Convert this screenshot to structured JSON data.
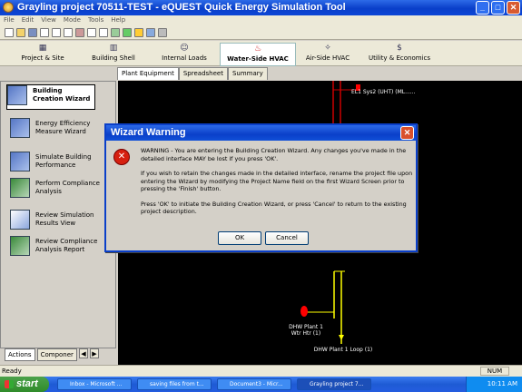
{
  "window": {
    "title": "Grayling project 70511-TEST - eQUEST Quick Energy Simulation Tool",
    "controls": {
      "minimize": "_",
      "maximize": "□",
      "close": "✕"
    }
  },
  "menu": [
    "File",
    "Edit",
    "View",
    "Mode",
    "Tools",
    "Help"
  ],
  "toolbar_icons": [
    "new-icon",
    "open-icon",
    "save-icon",
    "print-icon",
    "cut-icon",
    "copy-icon",
    "paste-icon",
    "undo-icon",
    "redo-icon",
    "properties-icon",
    "check-icon",
    "run-icon",
    "report-icon",
    "3d-view-icon"
  ],
  "modules": [
    {
      "label": "Project & Site",
      "icon": "▦"
    },
    {
      "label": "Building Shell",
      "icon": "▥"
    },
    {
      "label": "Internal Loads",
      "icon": "☺"
    },
    {
      "label": "Water-Side HVAC",
      "icon": "♨"
    },
    {
      "label": "Air-Side HVAC",
      "icon": "✧"
    },
    {
      "label": "Utility & Economics",
      "icon": "$"
    }
  ],
  "view_tabs": [
    "Plant Equipment",
    "Spreadsheet",
    "Summary"
  ],
  "actions": [
    "Building Creation Wizard",
    "Energy Efficiency Measure Wizard",
    "Simulate Building Performance",
    "Perform Compliance Analysis",
    "Review Simulation Results View",
    "Review Compliance Analysis Report"
  ],
  "left_tabs": {
    "actions": "Actions",
    "components": "Componer",
    "prev": "◀",
    "next": "▶"
  },
  "canvas_labels": {
    "system": "EL1 Sys2 (UHT) (ML......",
    "plant": "DHW Plant 1 Wtr Htr (1)",
    "loop": "DHW Plant 1 Loop (1)"
  },
  "dialog": {
    "title": "Wizard Warning",
    "icon": "error-icon",
    "lines": [
      "WARNING - You are entering the Building Creation Wizard.  Any changes you've made in the detailed interface MAY be lost if you press 'OK'.",
      "If you wish to retain the changes made in the detailed interface, rename the project file upon entering the Wizard by modifying the Project Name field on the first Wizard Screen prior to pressing the 'Finish' button.",
      "Press 'OK' to initiate the Building Creation Wizard, or press 'Cancel' to return to the existing project description."
    ],
    "ok": "OK",
    "cancel": "Cancel",
    "close": "✕"
  },
  "status": {
    "text": "Ready",
    "num": "NUM"
  },
  "taskbar": {
    "start": "start",
    "tasks": [
      "Inbox - Microsoft ...",
      "saving files from t...",
      "Document3 - Micr...",
      "Grayling project 7..."
    ],
    "time": "10:11 AM"
  },
  "colors": {
    "title_bar": "#0a3fc9",
    "canvas": "#000000",
    "pipe": "#ffff00",
    "equipment": "#ff0000",
    "dialog_border": "#0a3fc9"
  }
}
